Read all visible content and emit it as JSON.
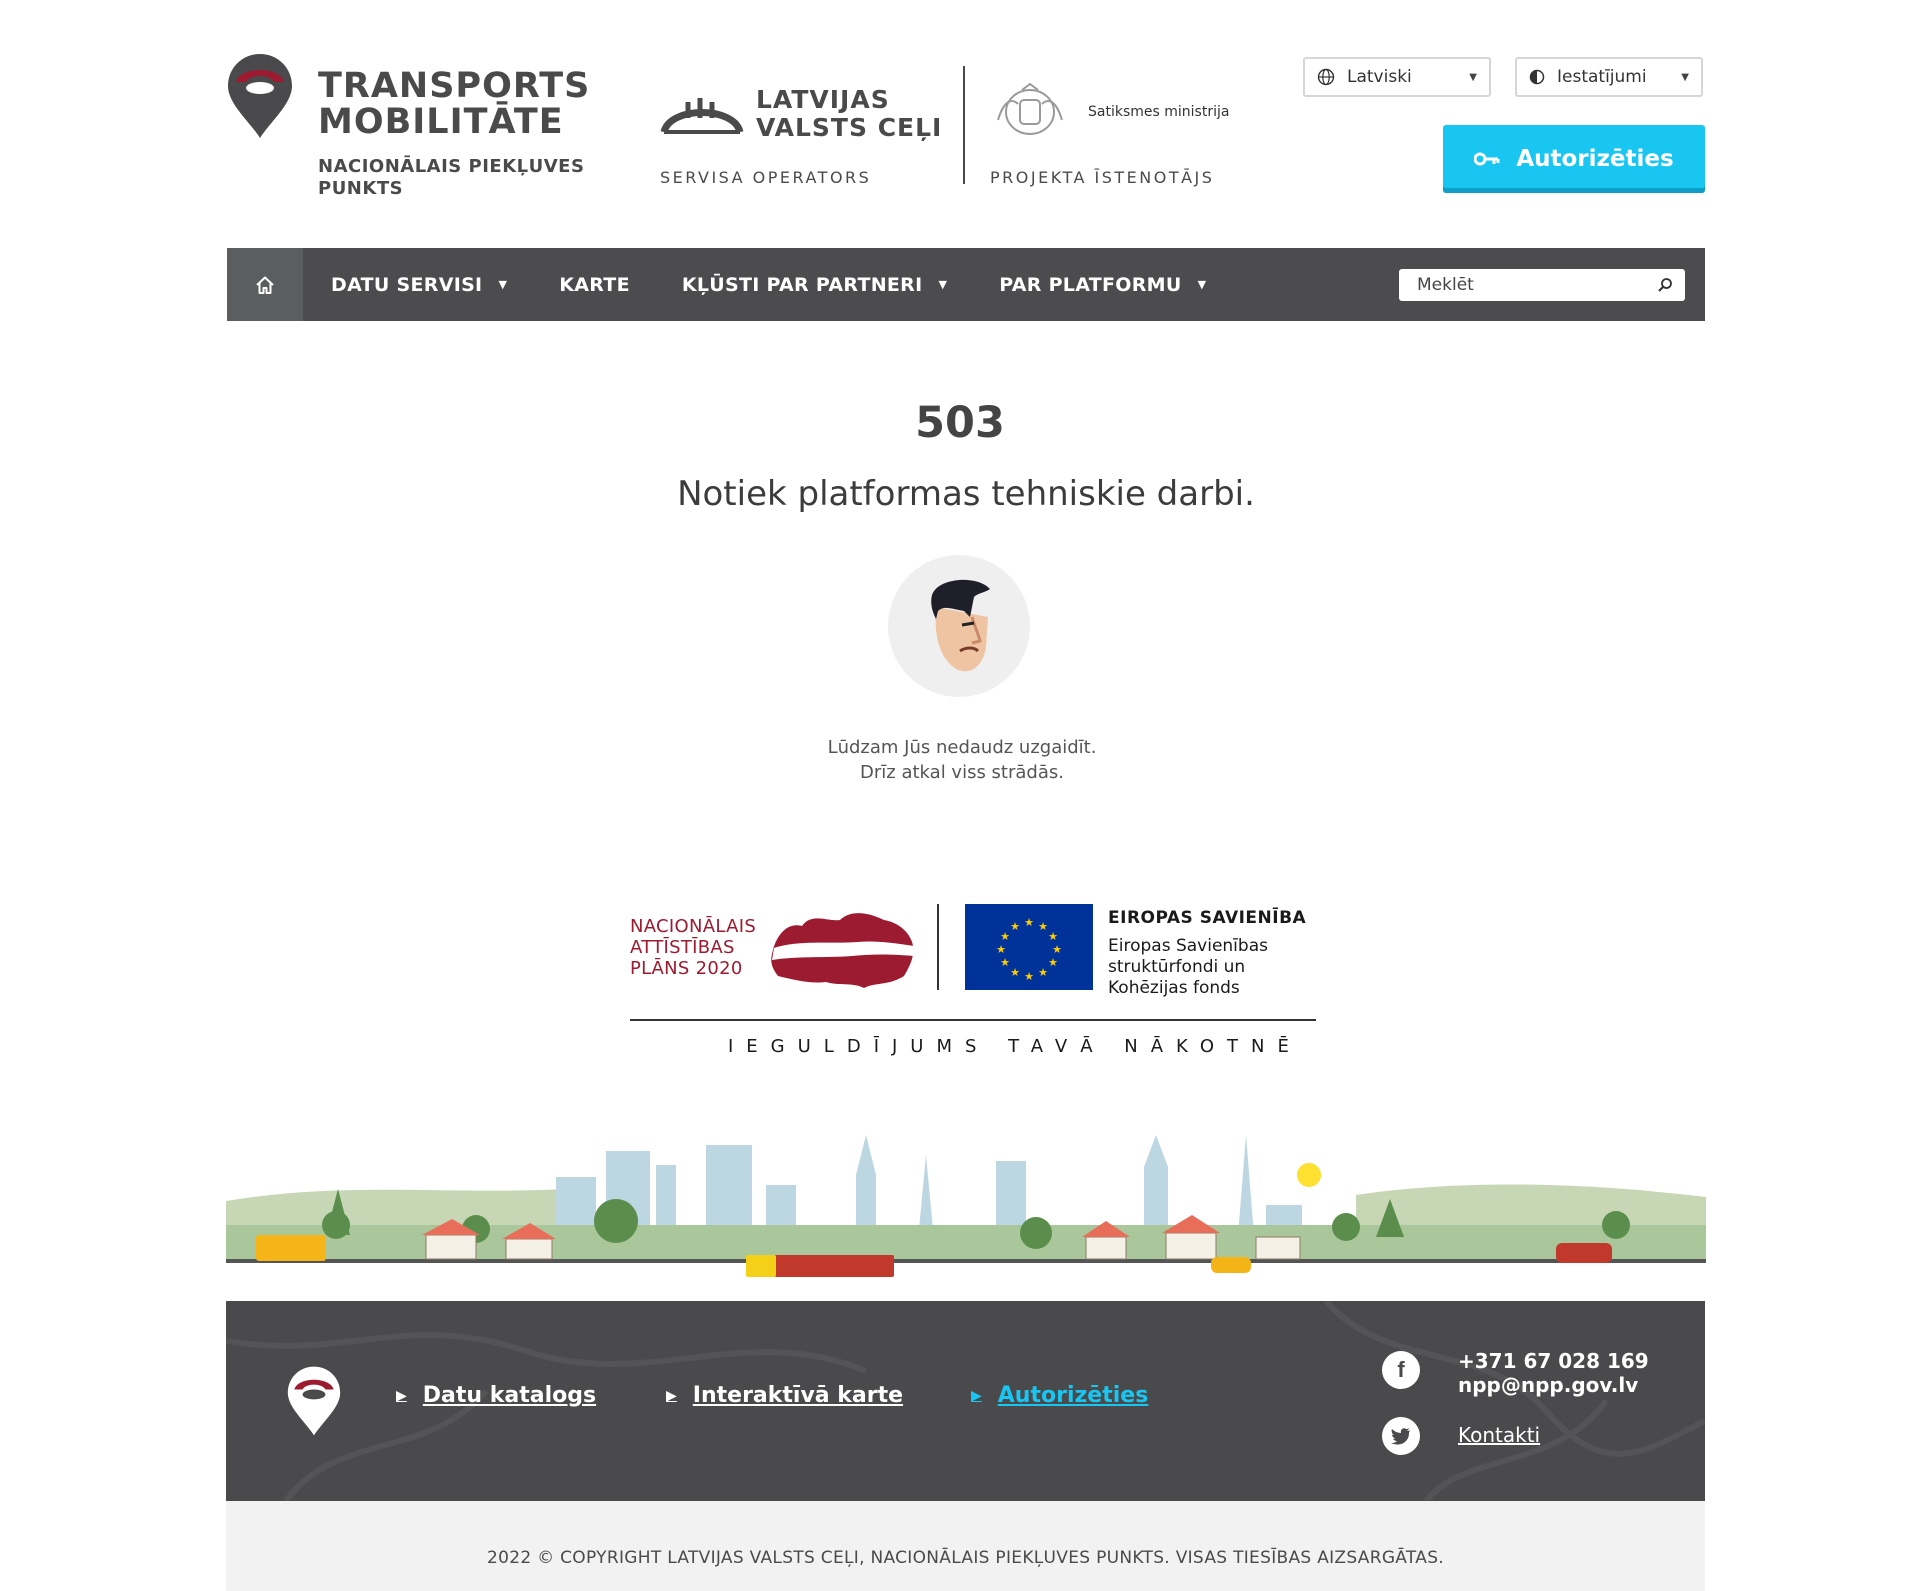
{
  "header": {
    "logo": {
      "title_line1": "TRANSPORTS",
      "title_line2": "MOBILITĀTE",
      "subtitle_line1": "NACIONĀLAIS PIEKĻUVES",
      "subtitle_line2": "PUNKTS"
    },
    "operator": {
      "name_line1": "LATVIJAS",
      "name_line2": "VALSTS CEĻI",
      "caption": "SERVISA OPERATORS"
    },
    "implementer": {
      "name": "Satiksmes ministrija",
      "caption": "PROJEKTA ĪSTENOTĀJS"
    },
    "language_select": {
      "value": "Latviski",
      "icon": "globe-icon"
    },
    "settings_select": {
      "value": "Iestatījumi",
      "icon": "contrast-icon"
    },
    "login_button": {
      "label": "Autorizēties",
      "icon": "key-icon"
    }
  },
  "nav": {
    "home_icon": "home-icon",
    "items": [
      {
        "label": "DATU SERVISI",
        "has_dropdown": true
      },
      {
        "label": "KARTE",
        "has_dropdown": false
      },
      {
        "label": "KĻŪSTI PAR PARTNERI",
        "has_dropdown": true
      },
      {
        "label": "PAR PLATFORMU",
        "has_dropdown": true
      }
    ],
    "search": {
      "placeholder": "Meklēt",
      "icon": "search-icon"
    }
  },
  "error": {
    "code": "503",
    "headline": "Notiek platformas tehniskie darbi.",
    "message_line1": "Lūdzam Jūs nedaudz uzgaidīt.",
    "message_line2": "Drīz atkal viss strādās."
  },
  "funding": {
    "nap_line1": "NACIONĀLAIS",
    "nap_line2": "ATTĪSTĪBAS",
    "nap_line3": "PLĀNS 2020",
    "eu_title": "EIROPAS SAVIENĪBA",
    "eu_line1": "Eiropas Savienības",
    "eu_line2": "struktūrfondi un",
    "eu_line3": "Kohēzijas fonds",
    "motto": "IEGULDĪJUMS TAVĀ NĀKOTNĒ"
  },
  "footer": {
    "links": [
      {
        "label": "Datu katalogs",
        "active": false
      },
      {
        "label": "Interaktīvā karte",
        "active": false
      },
      {
        "label": "Autorizēties",
        "active": true
      }
    ],
    "phone": "+371 67 028 169",
    "email": "npp@npp.gov.lv",
    "contacts_link": "Kontakti",
    "social": [
      "facebook-icon",
      "twitter-icon"
    ],
    "copyright": "2022 © COPYRIGHT LATVIJAS VALSTS CEĻI, NACIONĀLAIS PIEKĻUVES PUNKTS. VISAS TIESĪBAS AIZSARGĀTAS."
  },
  "colors": {
    "accent": "#19c6f2",
    "nav_bg": "#4c4c4e",
    "brand_red": "#9c1b30",
    "footer_bg": "#4a4a4c"
  }
}
